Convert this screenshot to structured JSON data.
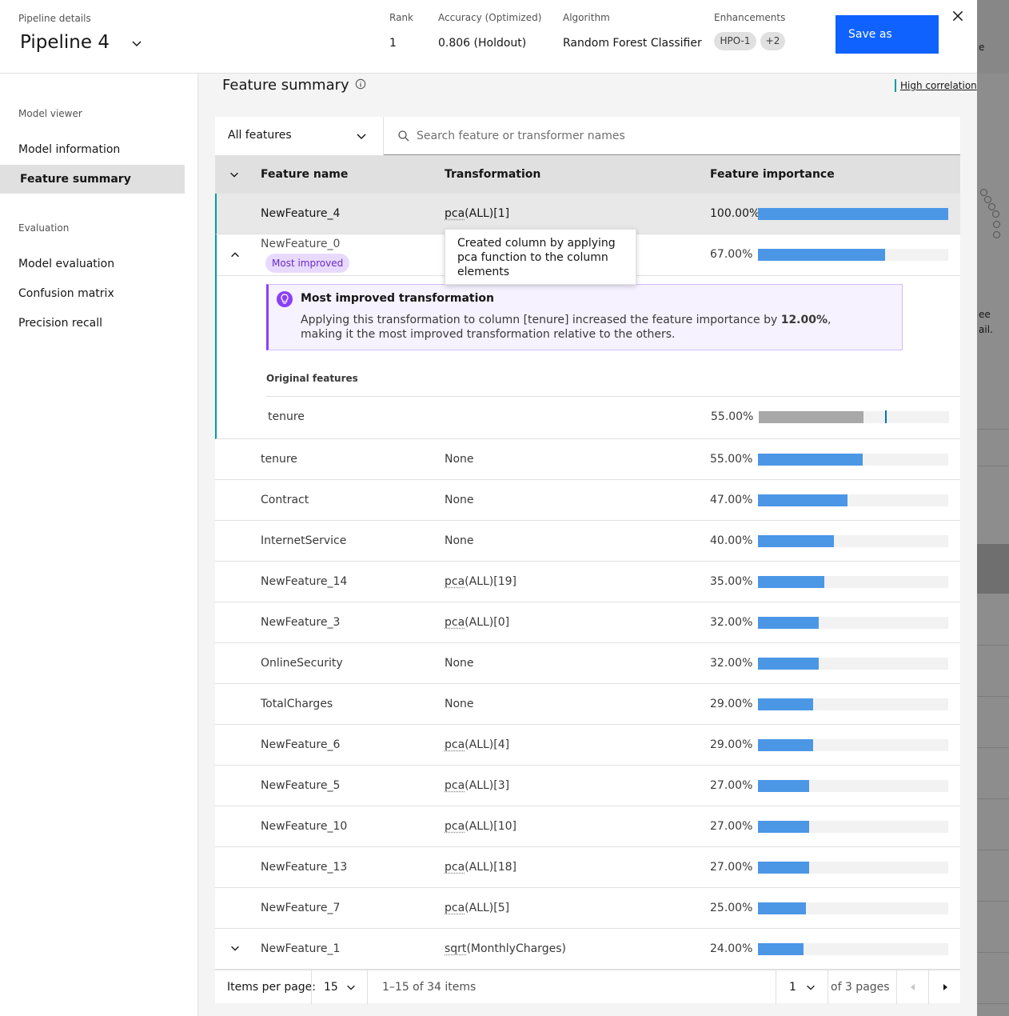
{
  "header": {
    "pipeline_label": "Pipeline details",
    "pipeline_name": "Pipeline 4",
    "rank_label": "Rank",
    "rank_value": "1",
    "accuracy_label": "Accuracy  (Optimized)",
    "accuracy_value": "0.806 (Holdout)",
    "algorithm_label": "Algorithm",
    "algorithm_value": "Random Forest Classifier",
    "enhancements_label": "Enhancements",
    "enhancements": [
      "HPO-1",
      "+2"
    ],
    "save_label": "Save as"
  },
  "sidebar": {
    "section1": "Model viewer",
    "items1": [
      "Model information",
      "Feature summary"
    ],
    "section2": "Evaluation",
    "items2": [
      "Model evaluation",
      "Confusion matrix",
      "Precision recall"
    ]
  },
  "main": {
    "title": "Feature summary",
    "legend": "High correlation",
    "filter_value": "All features",
    "search_placeholder": "Search feature or transformer names",
    "columns": [
      "Feature name",
      "Transformation",
      "Feature importance"
    ],
    "selected_row": {
      "name": "NewFeature_4",
      "fn": "pca",
      "arg": "(ALL)[1]",
      "pct": "100.00%",
      "value": 100
    },
    "tooltip": "Created column by applying pca function to the column elements",
    "expanded_row": {
      "name": "NewFeature_0",
      "tag": "Most improved",
      "pct": "67.00%",
      "value": 67,
      "notif_title": "Most improved transformation",
      "notif_body_pre": "Applying this transformation to column [tenure] increased the feature importance by ",
      "notif_body_bold": "12.00%",
      "notif_body_post": ", making it the most improved transformation relative to the others.",
      "original_label": "Original features",
      "original": {
        "name": "tenure",
        "pct": "55.00%",
        "value": 55,
        "marker": 67
      }
    },
    "rows": [
      {
        "name": "tenure",
        "fn": "",
        "arg": "None",
        "pct": "55.00%",
        "value": 55
      },
      {
        "name": "Contract",
        "fn": "",
        "arg": "None",
        "pct": "47.00%",
        "value": 47
      },
      {
        "name": "InternetService",
        "fn": "",
        "arg": "None",
        "pct": "40.00%",
        "value": 40
      },
      {
        "name": "NewFeature_14",
        "fn": "pca",
        "arg": "(ALL)[19]",
        "pct": "35.00%",
        "value": 35
      },
      {
        "name": "NewFeature_3",
        "fn": "pca",
        "arg": "(ALL)[0]",
        "pct": "32.00%",
        "value": 32
      },
      {
        "name": "OnlineSecurity",
        "fn": "",
        "arg": "None",
        "pct": "32.00%",
        "value": 32
      },
      {
        "name": "TotalCharges",
        "fn": "",
        "arg": "None",
        "pct": "29.00%",
        "value": 29
      },
      {
        "name": "NewFeature_6",
        "fn": "pca",
        "arg": "(ALL)[4]",
        "pct": "29.00%",
        "value": 29
      },
      {
        "name": "NewFeature_5",
        "fn": "pca",
        "arg": "(ALL)[3]",
        "pct": "27.00%",
        "value": 27
      },
      {
        "name": "NewFeature_10",
        "fn": "pca",
        "arg": "(ALL)[10]",
        "pct": "27.00%",
        "value": 27
      },
      {
        "name": "NewFeature_13",
        "fn": "pca",
        "arg": "(ALL)[18]",
        "pct": "27.00%",
        "value": 27
      },
      {
        "name": "NewFeature_7",
        "fn": "pca",
        "arg": "(ALL)[5]",
        "pct": "25.00%",
        "value": 25
      },
      {
        "name": "NewFeature_1",
        "fn": "sqrt",
        "arg": "(MonthlyCharges)",
        "pct": "24.00%",
        "value": 24,
        "expandable": true
      }
    ]
  },
  "pagination": {
    "items_per_page_label": "Items per page:",
    "items_per_page": "15",
    "range": "1–15 of 34 items",
    "page": "1",
    "of_pages": "of 3 pages"
  },
  "background": {
    "text1": "e",
    "text2": "ee",
    "text3": "ail."
  },
  "colors": {
    "accent": "#0f62fe",
    "bar": "#4b97e6",
    "teal": "#009d9a",
    "purple": "#8a3ffc"
  }
}
